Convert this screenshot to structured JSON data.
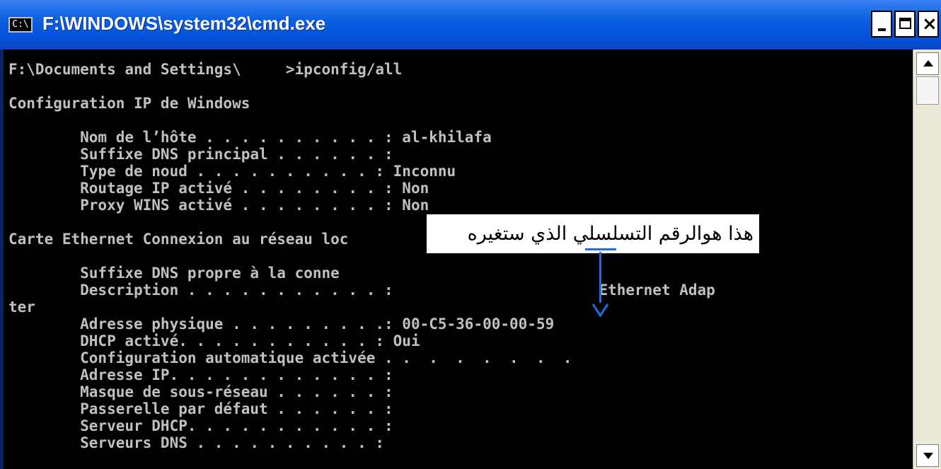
{
  "window": {
    "title": "F:\\WINDOWS\\system32\\cmd.exe",
    "icon": "cmd-icon",
    "icon_text": "C:\\"
  },
  "controls": {
    "minimize": "minimize-icon",
    "maximize": "maximize-icon",
    "close": "close-icon",
    "close_glyph": "×"
  },
  "console": {
    "lines": [
      "F:\\Documents and Settings\\     >ipconfig/all",
      "",
      "Configuration IP de Windows",
      "",
      "        Nom de l’hôte . . . . . . . . . . : al-khilafa",
      "        Suffixe DNS principal . . . . . . :",
      "        Type de noud . . . . . . . . . . : Inconnu",
      "        Routage IP activé . . . . . . . . : Non",
      "        Proxy WINS activé . . . . . . . . : Non",
      "",
      "Carte Ethernet Connexion au réseau loc",
      "",
      "        Suffixe DNS propre à la conne",
      "        Description . . . . . . . . . . . :                       Ethernet Adap",
      "ter",
      "        Adresse physique . . . . . . . . .: 00-C5-36-00-00-59",
      "        DHCP activé. . . . . . . . . . . : Oui",
      "        Configuration automatique activée . .  .  .  .  .  .  .",
      "        Adresse IP. . . . . . . . . . . . :",
      "        Masque de sous-réseau . . . . . . :",
      "        Passerelle par défaut . . . . . . :",
      "        Serveur DHCP. . . . . . . . . . . :",
      "        Serveurs DNS . . . . . . . . . . :"
    ],
    "text_color": "#c0c0c0",
    "background": "#000000"
  },
  "annotation": {
    "text": "هذا هوالرقم التسلسلي الذي  ستغيره",
    "arrow_color": "#1e6fd9"
  },
  "scrollbar": {
    "up": "scroll-up-arrow-icon",
    "down": "scroll-down-arrow-icon"
  }
}
